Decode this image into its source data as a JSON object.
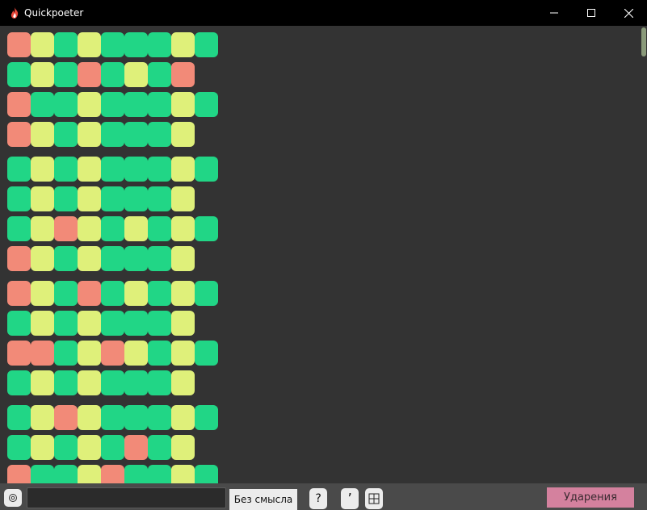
{
  "window": {
    "title": "Quickpoeter",
    "icons": {
      "app": "flame-icon",
      "minimize": "minimize-icon",
      "maximize": "maximize-icon",
      "close": "close-icon"
    }
  },
  "legend_colors": {
    "stressed": "#f28a78",
    "unstressed": "#21d686",
    "ambiguous": "#dff07a"
  },
  "grid": {
    "rows": [
      [
        "r",
        "y",
        "g",
        "y",
        "g",
        "g",
        "g",
        "y",
        "g"
      ],
      [
        "g",
        "y",
        "g",
        "r",
        "g",
        "y",
        "g",
        "r"
      ],
      [
        "r",
        "g",
        "g",
        "y",
        "g",
        "g",
        "g",
        "y",
        "g"
      ],
      [
        "r",
        "y",
        "g",
        "y",
        "g",
        "g",
        "g",
        "y"
      ],
      null,
      [
        "g",
        "y",
        "g",
        "y",
        "g",
        "g",
        "g",
        "y",
        "g"
      ],
      [
        "g",
        "y",
        "g",
        "y",
        "g",
        "g",
        "g",
        "y"
      ],
      [
        "g",
        "y",
        "r",
        "y",
        "g",
        "y",
        "g",
        "y",
        "g"
      ],
      [
        "r",
        "y",
        "g",
        "y",
        "g",
        "g",
        "g",
        "y"
      ],
      null,
      [
        "r",
        "y",
        "g",
        "r",
        "g",
        "y",
        "g",
        "y",
        "g"
      ],
      [
        "g",
        "y",
        "g",
        "y",
        "g",
        "g",
        "g",
        "y"
      ],
      [
        "r",
        "r",
        "g",
        "y",
        "r",
        "y",
        "g",
        "y",
        "g"
      ],
      [
        "g",
        "y",
        "g",
        "y",
        "g",
        "g",
        "g",
        "y"
      ],
      null,
      [
        "g",
        "y",
        "r",
        "y",
        "g",
        "g",
        "g",
        "y",
        "g"
      ],
      [
        "g",
        "y",
        "g",
        "y",
        "g",
        "r",
        "g",
        "y"
      ],
      [
        "r",
        "g",
        "g",
        "y",
        "r",
        "g",
        "g",
        "y",
        "g"
      ]
    ]
  },
  "toolbar": {
    "settings_icon": "gear-icon",
    "input_value": "",
    "mode_label": "Без смысла",
    "help_label": "?",
    "apostrophe_label": "’",
    "grid_icon": "grid-icon",
    "stress_label": "Ударения"
  }
}
